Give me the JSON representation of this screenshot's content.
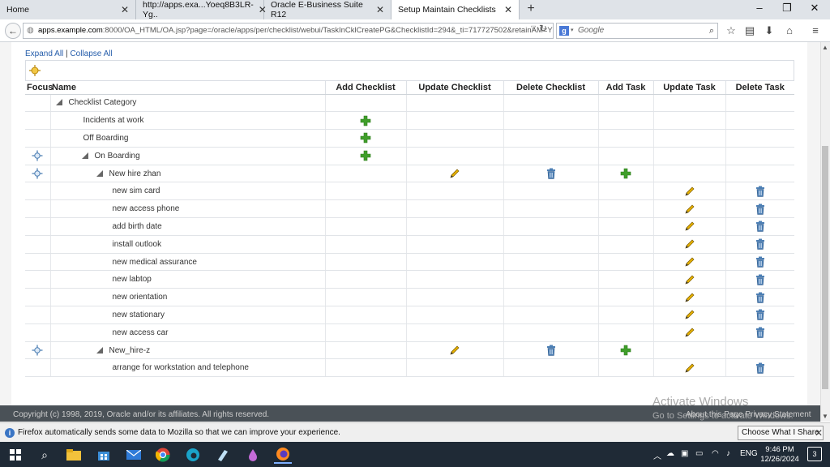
{
  "browser": {
    "tabs": [
      {
        "title": "Home"
      },
      {
        "title": "http://apps.exa...Yoeq8B3LR-Yg.."
      },
      {
        "title": "Oracle E-Business Suite R12"
      },
      {
        "title": "Setup Maintain Checklists"
      }
    ],
    "active_tab": 3,
    "new_tab_label": "+",
    "window_controls": {
      "minimize": "–",
      "restore": "❐",
      "close": "✕"
    },
    "url_host": "apps.example.com",
    "url_rest": ":8000/OA_HTML/OA.jsp?page=/oracle/apps/per/checklist/webui/TaskInCklCreatePG&ChecklistId=294&_ti=717727502&retainAM=Y&",
    "search_placeholder": "Google",
    "search_engine_letter": "g"
  },
  "page": {
    "expand_all": "Expand All",
    "separator": "|",
    "collapse_all": "Collapse All",
    "columns": {
      "focus": "Focus",
      "name": "Name",
      "add_checklist": "Add Checklist",
      "update_checklist": "Update Checklist",
      "delete_checklist": "Delete Checklist",
      "add_task": "Add Task",
      "update_task": "Update Task",
      "delete_task": "Delete Task"
    },
    "rows": [
      {
        "name": "Checklist Category",
        "level": 0,
        "expanded": true,
        "focus": false,
        "add_checklist": false,
        "update_checklist": false,
        "delete_checklist": false,
        "add_task": false,
        "update_task": false,
        "delete_task": false
      },
      {
        "name": "Incidents at work",
        "level": 1,
        "expanded": false,
        "focus": false,
        "add_checklist": true,
        "update_checklist": false,
        "delete_checklist": false,
        "add_task": false,
        "update_task": false,
        "delete_task": false
      },
      {
        "name": "Off Boarding",
        "level": 1,
        "expanded": false,
        "focus": false,
        "add_checklist": true,
        "update_checklist": false,
        "delete_checklist": false,
        "add_task": false,
        "update_task": false,
        "delete_task": false
      },
      {
        "name": "On Boarding",
        "level": 1,
        "expanded": true,
        "focus": true,
        "add_checklist": true,
        "update_checklist": false,
        "delete_checklist": false,
        "add_task": false,
        "update_task": false,
        "delete_task": false
      },
      {
        "name": "New hire zhan",
        "level": 2,
        "expanded": true,
        "focus": true,
        "add_checklist": false,
        "update_checklist": true,
        "delete_checklist": true,
        "add_task": true,
        "update_task": false,
        "delete_task": false
      },
      {
        "name": "new sim card",
        "level": 3,
        "expanded": false,
        "focus": false,
        "add_checklist": false,
        "update_checklist": false,
        "delete_checklist": false,
        "add_task": false,
        "update_task": true,
        "delete_task": true
      },
      {
        "name": "new access phone",
        "level": 3,
        "expanded": false,
        "focus": false,
        "add_checklist": false,
        "update_checklist": false,
        "delete_checklist": false,
        "add_task": false,
        "update_task": true,
        "delete_task": true
      },
      {
        "name": "add birth date",
        "level": 3,
        "expanded": false,
        "focus": false,
        "add_checklist": false,
        "update_checklist": false,
        "delete_checklist": false,
        "add_task": false,
        "update_task": true,
        "delete_task": true
      },
      {
        "name": "install outlook",
        "level": 3,
        "expanded": false,
        "focus": false,
        "add_checklist": false,
        "update_checklist": false,
        "delete_checklist": false,
        "add_task": false,
        "update_task": true,
        "delete_task": true
      },
      {
        "name": "new medical assurance",
        "level": 3,
        "expanded": false,
        "focus": false,
        "add_checklist": false,
        "update_checklist": false,
        "delete_checklist": false,
        "add_task": false,
        "update_task": true,
        "delete_task": true
      },
      {
        "name": "new labtop",
        "level": 3,
        "expanded": false,
        "focus": false,
        "add_checklist": false,
        "update_checklist": false,
        "delete_checklist": false,
        "add_task": false,
        "update_task": true,
        "delete_task": true
      },
      {
        "name": "new orientation",
        "level": 3,
        "expanded": false,
        "focus": false,
        "add_checklist": false,
        "update_checklist": false,
        "delete_checklist": false,
        "add_task": false,
        "update_task": true,
        "delete_task": true
      },
      {
        "name": "new stationary",
        "level": 3,
        "expanded": false,
        "focus": false,
        "add_checklist": false,
        "update_checklist": false,
        "delete_checklist": false,
        "add_task": false,
        "update_task": true,
        "delete_task": true
      },
      {
        "name": "new access car",
        "level": 3,
        "expanded": false,
        "focus": false,
        "add_checklist": false,
        "update_checklist": false,
        "delete_checklist": false,
        "add_task": false,
        "update_task": true,
        "delete_task": true
      },
      {
        "name": "New_hire-z",
        "level": 2,
        "expanded": true,
        "focus": true,
        "add_checklist": false,
        "update_checklist": true,
        "delete_checklist": true,
        "add_task": true,
        "update_task": false,
        "delete_task": false
      },
      {
        "name": "arrange for workstation and telephone",
        "level": 3,
        "expanded": false,
        "focus": false,
        "add_checklist": false,
        "update_checklist": false,
        "delete_checklist": false,
        "add_task": false,
        "update_task": true,
        "delete_task": true
      }
    ],
    "copyright": "Copyright (c) 1998, 2019, Oracle and/or its affiliates. All rights reserved.",
    "about_page": "About this Page",
    "privacy": "Privacy Statement",
    "watermark_line1": "Activate Windows",
    "watermark_line2": "Go to Settings to activate Windows."
  },
  "notification": {
    "message": "Firefox automatically sends some data to Mozilla so that we can improve your experience.",
    "button": "Choose What I Share",
    "info_glyph": "i"
  },
  "taskbar": {
    "language": "ENG",
    "time": "9:46 PM",
    "date": "12/26/2024",
    "notification_count": "3"
  },
  "colors": {
    "link": "#245caa",
    "add_icon": "#3f9e2a",
    "pencil": "#e6b100",
    "trash": "#4d7fb4",
    "footer_band": "#4a5157",
    "taskbar": "#1f2a36"
  }
}
